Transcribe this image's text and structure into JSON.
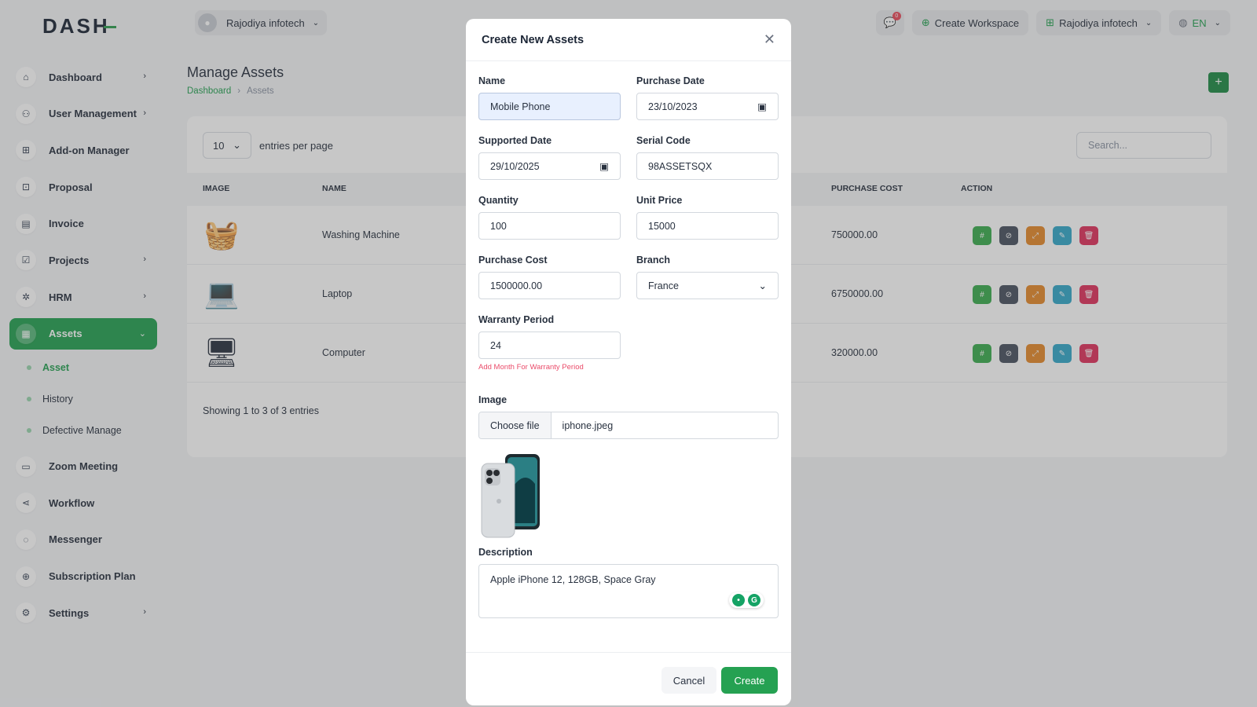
{
  "brand": {
    "logo_text": "DASH"
  },
  "sidebar": {
    "items": [
      {
        "label": "Dashboard",
        "icon": "home-icon",
        "chev": "›"
      },
      {
        "label": "User Management",
        "icon": "users-icon",
        "chev": "›"
      },
      {
        "label": "Add-on Manager",
        "icon": "grid-icon",
        "chev": ""
      },
      {
        "label": "Proposal",
        "icon": "proposal-icon",
        "chev": ""
      },
      {
        "label": "Invoice",
        "icon": "invoice-icon",
        "chev": ""
      },
      {
        "label": "Projects",
        "icon": "projects-icon",
        "chev": "›"
      },
      {
        "label": "HRM",
        "icon": "hrm-icon",
        "chev": "›"
      },
      {
        "label": "Assets",
        "icon": "assets-icon",
        "chev": "⌄"
      },
      {
        "label": "Zoom Meeting",
        "icon": "video-icon",
        "chev": ""
      },
      {
        "label": "Workflow",
        "icon": "workflow-icon",
        "chev": ""
      },
      {
        "label": "Messenger",
        "icon": "chat-icon",
        "chev": ""
      },
      {
        "label": "Subscription Plan",
        "icon": "search-plan-icon",
        "chev": ""
      },
      {
        "label": "Settings",
        "icon": "gear-icon",
        "chev": "›"
      }
    ],
    "sub_items": [
      "Asset",
      "History",
      "Defective Manage"
    ]
  },
  "topbar": {
    "workspace_user": "Rajodiya infotech",
    "notification_count": "0",
    "create_workspace": "Create Workspace",
    "workspace_switch": "Rajodiya infotech",
    "language": "EN"
  },
  "page": {
    "title": "Manage Assets",
    "breadcrumb": [
      "Dashboard",
      "Assets"
    ],
    "entries_value": "10",
    "entries_label": "entries per page",
    "search_placeholder": "Search...",
    "columns": [
      "IMAGE",
      "NAME",
      "PURCHASE COST",
      "ACTION"
    ],
    "rows": [
      {
        "name": "Washing Machine",
        "cost": "750000.00",
        "icon": "washing-machine-icon"
      },
      {
        "name": "Laptop",
        "cost": "6750000.00",
        "icon": "laptop-icon"
      },
      {
        "name": "Computer",
        "cost": "320000.00",
        "icon": "computer-icon"
      }
    ],
    "showing": "Showing 1 to 3 of 3 entries"
  },
  "modal": {
    "title": "Create New Assets",
    "name_label": "Name",
    "name_value": "Mobile Phone",
    "purchase_date_label": "Purchase Date",
    "purchase_date_value": "23/10/2023",
    "supported_date_label": "Supported Date",
    "supported_date_value": "29/10/2025",
    "serial_code_label": "Serial Code",
    "serial_code_value": "98ASSETSQX",
    "quantity_label": "Quantity",
    "quantity_value": "100",
    "unit_price_label": "Unit Price",
    "unit_price_value": "15000",
    "purchase_cost_label": "Purchase Cost",
    "purchase_cost_value": "1500000.00",
    "branch_label": "Branch",
    "branch_value": "France",
    "warranty_label": "Warranty Period",
    "warranty_value": "24",
    "warranty_hint": "Add Month For Warranty Period",
    "image_label": "Image",
    "choose_file": "Choose file",
    "file_name": "iphone.jpeg",
    "description_label": "Description",
    "description_value": "Apple iPhone 12, 128GB, Space Gray",
    "cancel": "Cancel",
    "create": "Create"
  },
  "colors": {
    "accent": "#25a152",
    "action_colors": [
      "#3cac4f",
      "#4a5260",
      "#e58a2c",
      "#34a8c9",
      "#e0335e"
    ]
  }
}
